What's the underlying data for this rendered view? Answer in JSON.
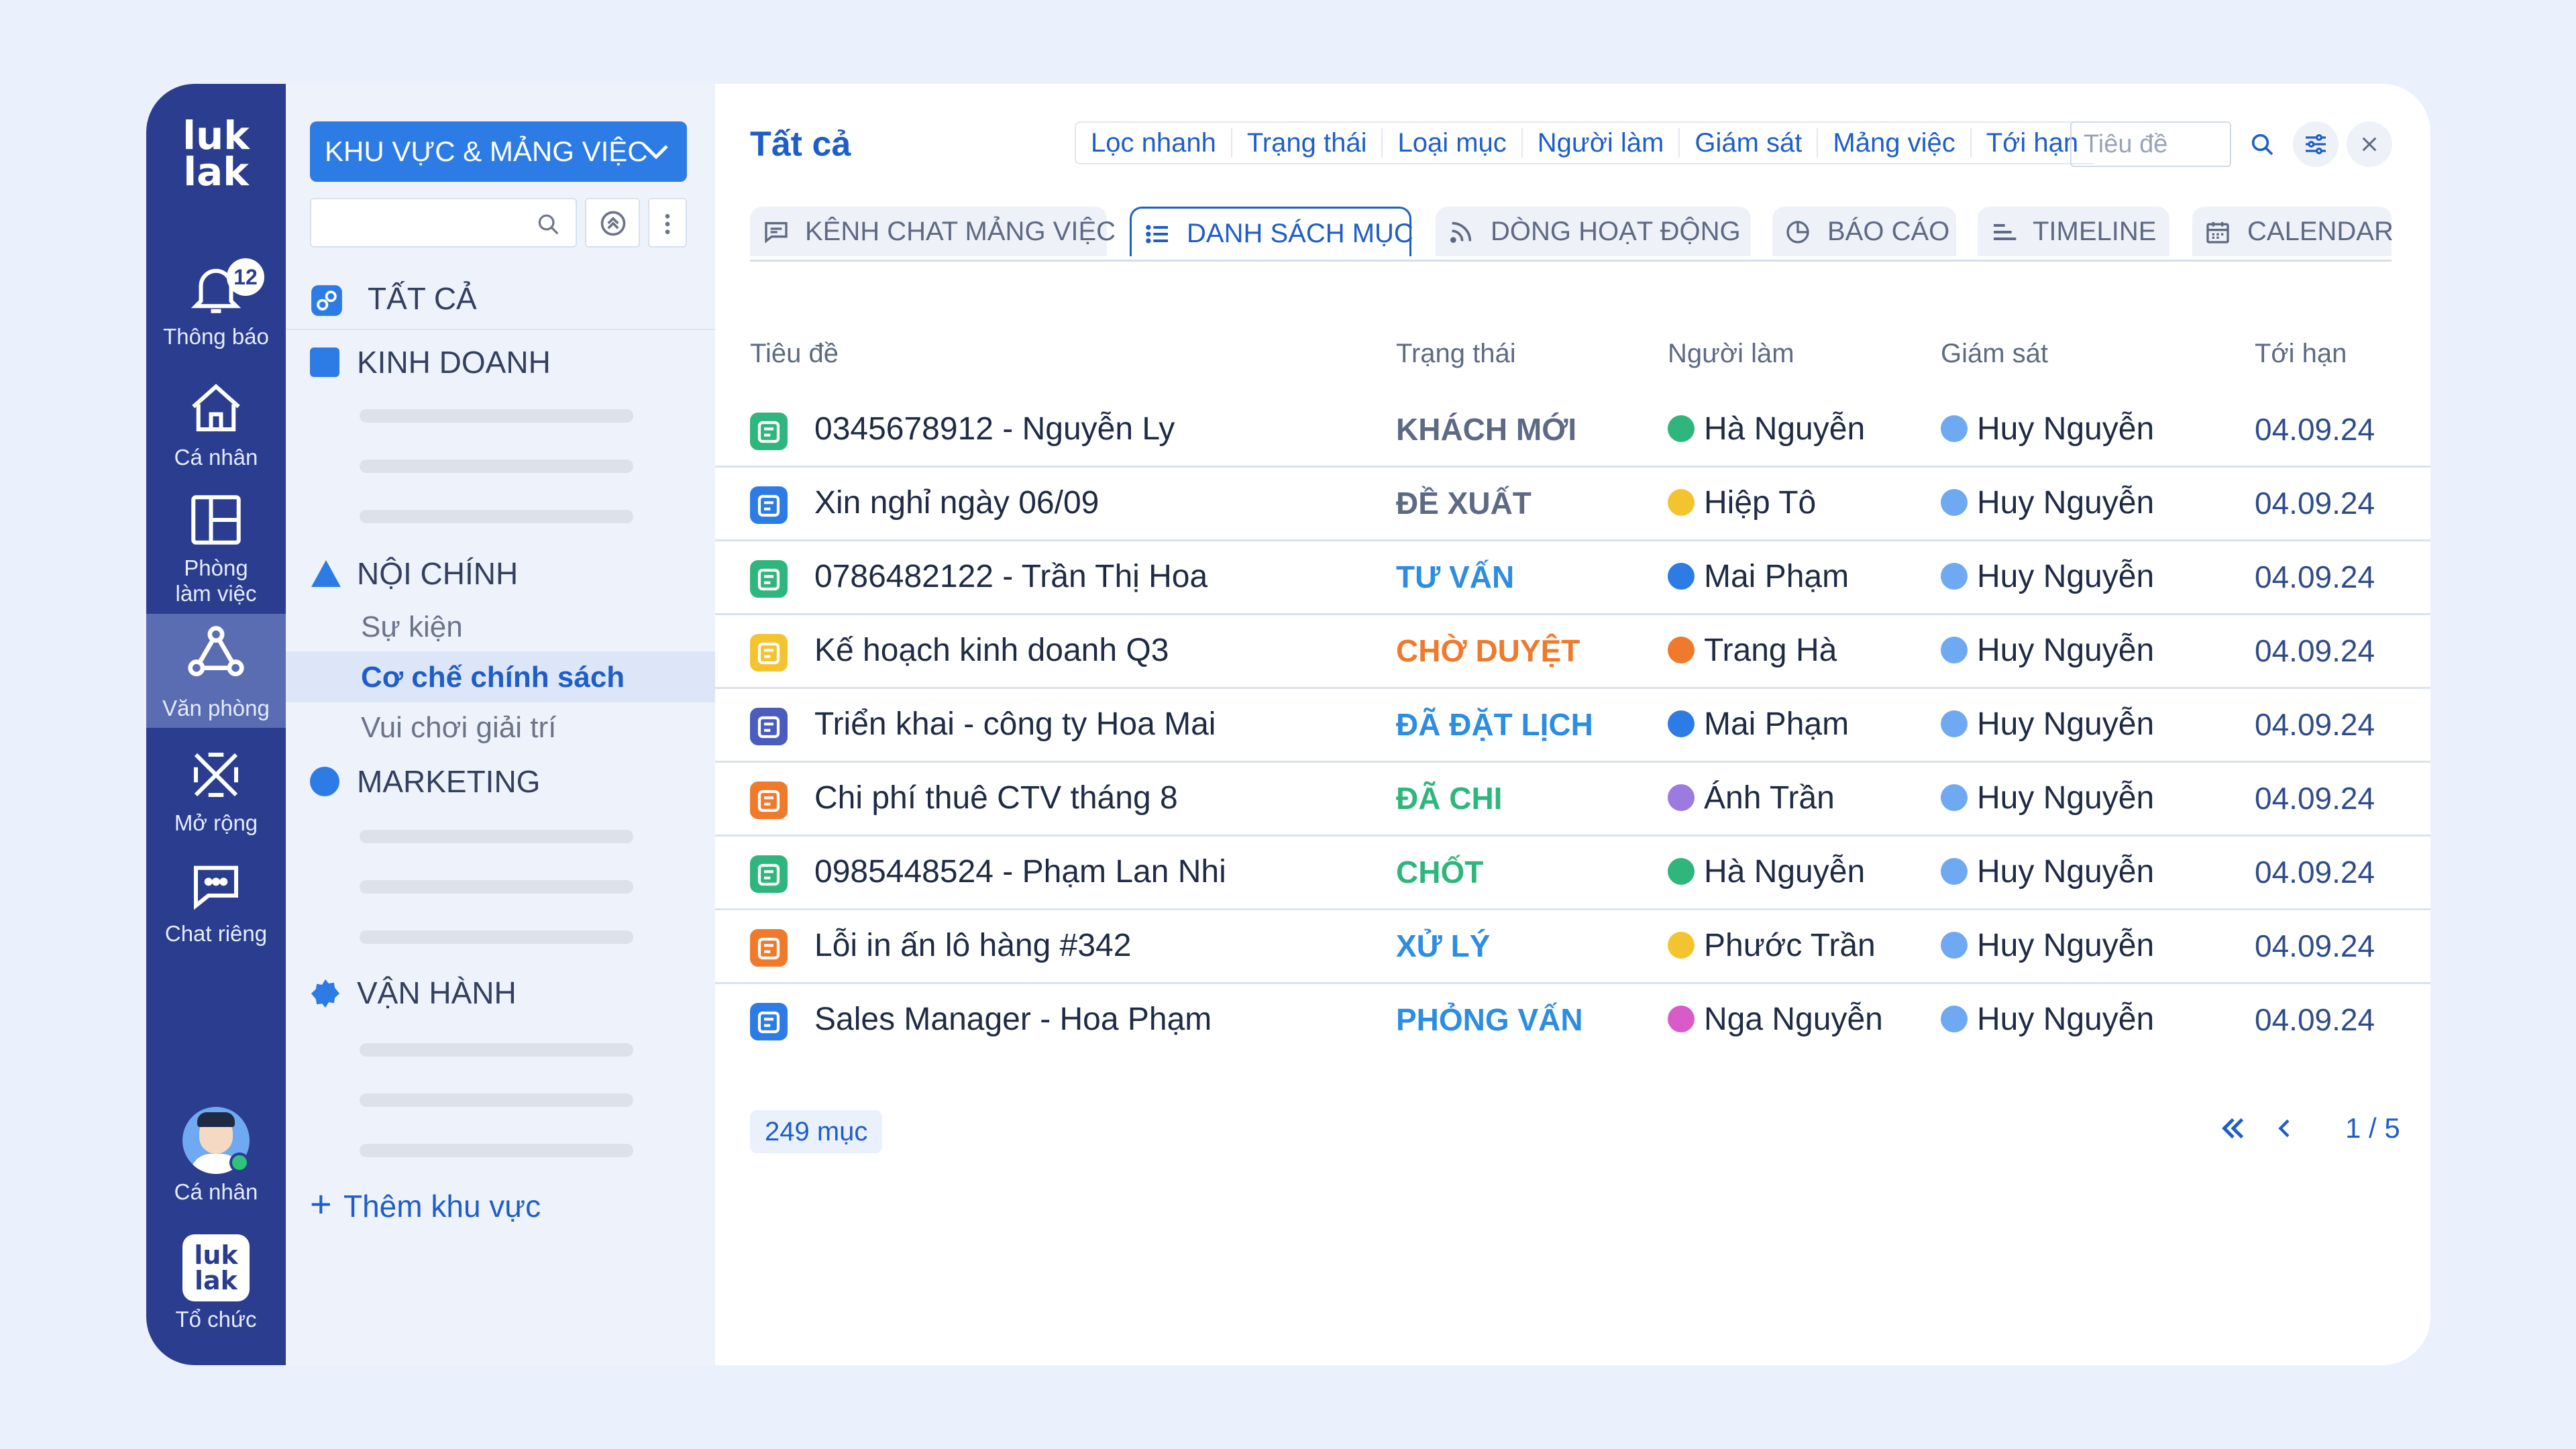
{
  "rail": {
    "logo": "luk lak",
    "items": [
      {
        "label": "Thông báo",
        "icon": "bell-icon",
        "badge": "12"
      },
      {
        "label": "Cá nhân",
        "icon": "home-icon"
      },
      {
        "label": "Phòng làm việc",
        "icon": "layout-icon"
      },
      {
        "label": "Văn phòng",
        "icon": "office-network-icon",
        "active": true
      },
      {
        "label": "Mở rộng",
        "icon": "extend-icon"
      },
      {
        "label": "Chat riêng",
        "icon": "chat-icon"
      }
    ],
    "profile_label": "Cá nhân",
    "org_label": "Tổ chức",
    "org_logo": "luk lak"
  },
  "sidebar": {
    "area_button": "KHU VỰC & MẢNG VIỆC",
    "search_placeholder": "",
    "all_label": "TẤT CẢ",
    "groups": [
      {
        "label": "KINH DOANH",
        "color": "#2D7BE5",
        "shape": "square"
      },
      {
        "label": "NỘI CHÍNH",
        "color": "#2D7BE5",
        "shape": "triangle",
        "children": [
          "Sự kiện",
          "Cơ chế chính sách",
          "Vui chơi giải trí"
        ],
        "selected": "Cơ chế chính sách"
      },
      {
        "label": "MARKETING",
        "color": "#2D7BE5",
        "shape": "circle"
      },
      {
        "label": "VẬN HÀNH",
        "color": "#2D7BE5",
        "shape": "gear"
      }
    ],
    "add_area": "Thêm khu vực"
  },
  "header": {
    "title": "Tất cả",
    "filters": [
      "Lọc nhanh",
      "Trạng thái",
      "Loại mục",
      "Người làm",
      "Giám sát",
      "Mảng việc",
      "Tới hạn"
    ],
    "search_placeholder": "Tiêu đề"
  },
  "tabs": [
    {
      "label": "KÊNH CHAT MẢNG VIỆC",
      "icon": "chat-channel-icon"
    },
    {
      "label": "DANH SÁCH MỤC",
      "icon": "list-icon",
      "active": true
    },
    {
      "label": "DÒNG HOẠT ĐỘNG",
      "icon": "rss-icon"
    },
    {
      "label": "BÁO CÁO",
      "icon": "pie-chart-icon"
    },
    {
      "label": "TIMELINE",
      "icon": "timeline-icon"
    },
    {
      "label": "CALENDAR",
      "icon": "calendar-icon"
    }
  ],
  "table": {
    "columns": [
      "Tiêu đề",
      "Trạng thái",
      "Người làm",
      "Giám sát",
      "Tới hạn"
    ],
    "rows": [
      {
        "title": "0345678912 - Nguyễn Ly",
        "status": "KHÁCH MỚI",
        "status_color": "#5E6A83",
        "assignee": "Hà Nguyễn",
        "supervisor": "Huy Nguyễn",
        "due": "04.09.24",
        "icon_color": "#2FB67C",
        "icon": "contact-icon"
      },
      {
        "title": "Xin nghỉ ngày 06/09",
        "status": "ĐỀ XUẤT",
        "status_color": "#5E6A83",
        "assignee": "Hiệp Tô",
        "supervisor": "Huy Nguyễn",
        "due": "04.09.24",
        "icon_color": "#2D7BE5",
        "icon": "leave-icon"
      },
      {
        "title": "0786482122 - Trần Thị Hoa",
        "status": "TƯ VẤN",
        "status_color": "#2D8DE0",
        "assignee": "Mai Phạm",
        "supervisor": "Huy Nguyễn",
        "due": "04.09.24",
        "icon_color": "#2FB67C",
        "icon": "contact-icon"
      },
      {
        "title": "Kế hoạch kinh doanh Q3",
        "status": "CHỜ DUYỆT",
        "status_color": "#F07A2B",
        "assignee": "Trang Hà",
        "supervisor": "Huy Nguyễn",
        "due": "04.09.24",
        "icon_color": "#F4C430",
        "icon": "idea-icon"
      },
      {
        "title": "Triển khai - công ty Hoa Mai",
        "status": "ĐÃ ĐẶT LỊCH",
        "status_color": "#2D8DE0",
        "assignee": "Mai Phạm",
        "supervisor": "Huy Nguyễn",
        "due": "04.09.24",
        "icon_color": "#4A5DBF",
        "icon": "calendar-icon"
      },
      {
        "title": "Chi phí thuê CTV tháng 8",
        "status": "ĐÃ CHI",
        "status_color": "#2FB67C",
        "assignee": "Ánh Trần",
        "supervisor": "Huy Nguyễn",
        "due": "04.09.24",
        "icon_color": "#F07A2B",
        "icon": "money-icon"
      },
      {
        "title": "0985448524 - Phạm Lan Nhi",
        "status": "CHỐT",
        "status_color": "#2FB67C",
        "assignee": "Hà Nguyễn",
        "supervisor": "Huy Nguyễn",
        "due": "04.09.24",
        "icon_color": "#2FB67C",
        "icon": "contact-icon"
      },
      {
        "title": "Lỗi in ấn lô hàng #342",
        "status": "XỬ LÝ",
        "status_color": "#2D8DE0",
        "assignee": "Phước Trần",
        "supervisor": "Huy Nguyễn",
        "due": "04.09.24",
        "icon_color": "#F07A2B",
        "icon": "ticket-icon"
      },
      {
        "title": "Sales Manager - Hoa Phạm",
        "status": "PHỎNG VẤN",
        "status_color": "#2D8DE0",
        "assignee": "Nga Nguyễn",
        "supervisor": "Huy Nguyễn",
        "due": "04.09.24",
        "icon_color": "#2D7BE5",
        "icon": "profile-card-icon"
      }
    ],
    "avatar_colors": [
      "#2FB67C",
      "#F4C430",
      "#2D7BE5",
      "#F07A2B",
      "#2D7BE5",
      "#9B7BE0",
      "#2FB67C",
      "#F4C430",
      "#D95BC9"
    ]
  },
  "footer": {
    "count": "249 mục",
    "page": "1 / 5"
  }
}
